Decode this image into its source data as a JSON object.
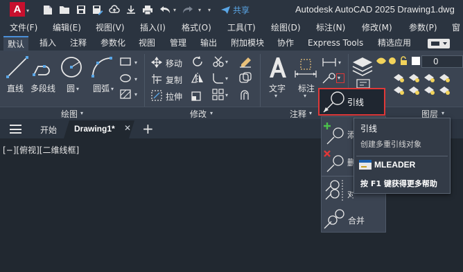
{
  "app": {
    "logo": "A",
    "logo_caret": "▾",
    "title": "Autodesk AutoCAD 2025    Drawing1.dwg",
    "share": "共享",
    "brand_color": "#c8102e",
    "share_color": "#5aa6e6"
  },
  "quick_access": [
    "new-file-icon",
    "open-folder-icon",
    "save-icon",
    "save-as-icon",
    "cloud-save-icon",
    "print-icon",
    "undo-icon",
    "redo-icon",
    "share-icon"
  ],
  "menu": [
    "文件(F)",
    "编辑(E)",
    "视图(V)",
    "插入(I)",
    "格式(O)",
    "工具(T)",
    "绘图(D)",
    "标注(N)",
    "修改(M)",
    "参数(P)",
    "窗"
  ],
  "ribbon_tabs": [
    "默认",
    "插入",
    "注释",
    "参数化",
    "视图",
    "管理",
    "输出",
    "附加模块",
    "协作",
    "Express Tools",
    "精选应用"
  ],
  "active_tab": "默认",
  "draw_panel": {
    "tools": [
      "直线",
      "多段线",
      "圆",
      "圆弧"
    ],
    "label": "绘图"
  },
  "modify_panel": {
    "tools": [
      "移动",
      "复制",
      "拉伸"
    ],
    "label": "修改"
  },
  "annotation_panel": {
    "tools": [
      "文字",
      "标注"
    ],
    "label": "注释"
  },
  "layer_panel": {
    "label": "图层",
    "layer_value": "0"
  },
  "panel_caret": "▾",
  "leader_button": {
    "label": "引线",
    "highlight_color": "#e03838"
  },
  "leader_menu": {
    "items": [
      "添",
      "删",
      "对齐",
      "合并"
    ]
  },
  "tooltip": {
    "title": "引线",
    "description": "创建多重引线对象",
    "command": "MLEADER",
    "help": "按 F1 键获得更多帮助"
  },
  "file_tabs": {
    "start": "开始",
    "active": "Drawing1*",
    "close": "✕",
    "add": "+"
  },
  "viewport": {
    "label": "[−][俯视][二维线框]"
  }
}
